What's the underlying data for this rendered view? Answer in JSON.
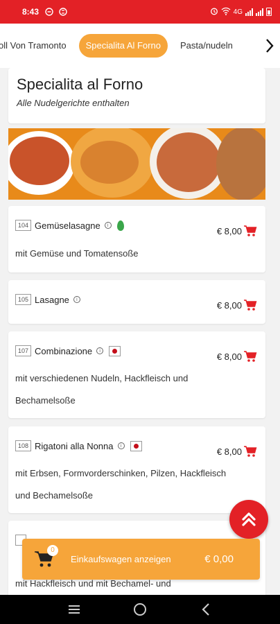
{
  "status": {
    "time": "8:43",
    "network": "4G"
  },
  "tabs": {
    "items": [
      "oll Von Tramonto",
      "Specialita Al Forno",
      "Pasta/nudeln"
    ],
    "active": 1
  },
  "section": {
    "title": "Specialita al Forno",
    "subtitle": "Alle Nudelgerichte enthalten"
  },
  "items": [
    {
      "number": "104",
      "name": "Gemüselasagne",
      "price": "€ 8,00",
      "description": "mit Gemüse und Tomatensoße",
      "badge": "leaf-icon"
    },
    {
      "number": "105",
      "name": "Lasagne",
      "price": "€ 8,00",
      "description": "",
      "badge": ""
    },
    {
      "number": "107",
      "name": "Combinazione",
      "price": "€ 8,00",
      "description_lines": [
        "mit verschiedenen Nudeln, Hackfleisch und",
        "Bechamelsoße"
      ],
      "badge": "flag-icon"
    },
    {
      "number": "108",
      "name": "Rigatoni alla Nonna",
      "price": "€ 8,00",
      "description_lines": [
        "mit Erbsen, Formvorderschinken, Pilzen, Hackfleisch",
        "und Bechamelsoße"
      ],
      "badge": "flag-icon"
    }
  ],
  "partial_item": {
    "description": "mit Hackfleisch und mit Bechamel- und"
  },
  "cart": {
    "count": "0",
    "label": "Einkaufswagen anzeigen",
    "total": "€ 0,00"
  },
  "colors": {
    "brand_red": "#e32126",
    "accent_orange": "#f6a53a"
  }
}
